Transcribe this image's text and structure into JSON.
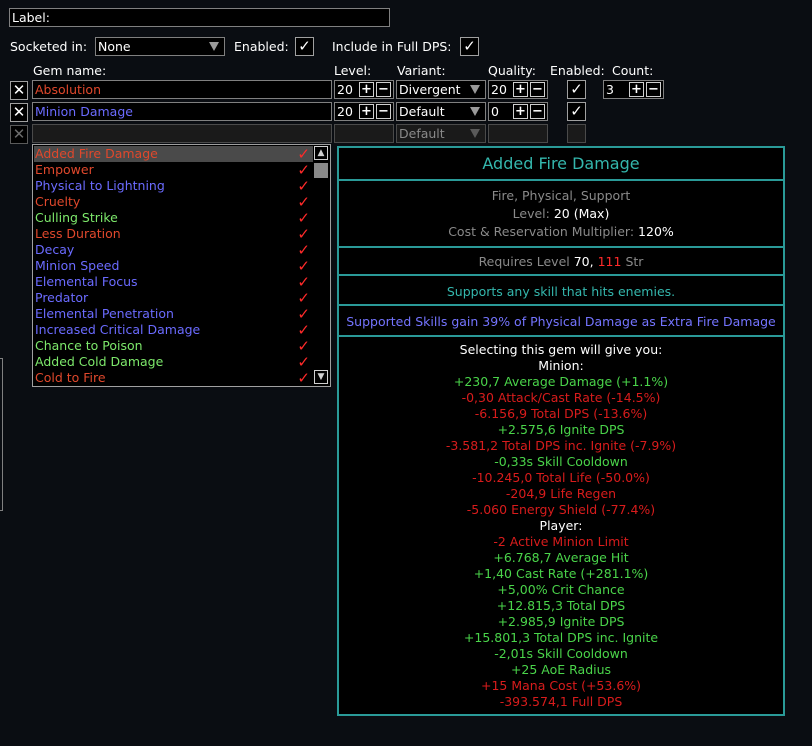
{
  "label_field": {
    "label": "Label:",
    "value": ""
  },
  "socketed_in": {
    "label": "Socketed in:",
    "value": "None"
  },
  "enabled": {
    "label": "Enabled:",
    "checked": "✓"
  },
  "include_full_dps": {
    "label": "Include in Full DPS:",
    "checked": "✓"
  },
  "headers": {
    "gem_name": "Gem name:",
    "level": "Level:",
    "variant": "Variant:",
    "quality": "Quality:",
    "enabled": "Enabled:",
    "count": "Count:"
  },
  "buttons": {
    "remove": "✕",
    "plus": "+",
    "minus": "−",
    "check": "✓",
    "scroll_up": "▲",
    "scroll_down": "▼"
  },
  "gems": [
    {
      "name": "Absolution",
      "color": "str",
      "level": "20",
      "variant": "Divergent",
      "quality": "20",
      "enabled": "✓",
      "count": "3"
    },
    {
      "name": "Minion Damage",
      "color": "int",
      "level": "20",
      "variant": "Default",
      "quality": "0",
      "enabled": "✓"
    },
    {
      "name": "",
      "level": "",
      "variant": "Default",
      "quality": "",
      "enabled": ""
    }
  ],
  "gem_list": [
    {
      "name": "Added Fire Damage",
      "color": "str",
      "selected": true
    },
    {
      "name": "Empower",
      "color": "str"
    },
    {
      "name": "Physical to Lightning",
      "color": "int"
    },
    {
      "name": "Cruelty",
      "color": "str"
    },
    {
      "name": "Culling Strike",
      "color": "dex"
    },
    {
      "name": "Less Duration",
      "color": "str"
    },
    {
      "name": "Decay",
      "color": "int"
    },
    {
      "name": "Minion Speed",
      "color": "int"
    },
    {
      "name": "Elemental Focus",
      "color": "int"
    },
    {
      "name": "Predator",
      "color": "int"
    },
    {
      "name": "Elemental Penetration",
      "color": "int"
    },
    {
      "name": "Increased Critical Damage",
      "color": "int"
    },
    {
      "name": "Chance to Poison",
      "color": "dex"
    },
    {
      "name": "Added Cold Damage",
      "color": "dex"
    },
    {
      "name": "Cold to Fire",
      "color": "str"
    }
  ],
  "tooltip": {
    "title": "Added Fire Damage",
    "tags": "Fire, Physical, Support",
    "level_label": "Level:",
    "level_value": "20 (Max)",
    "cost_label": "Cost & Reservation Multiplier:",
    "cost_value": "120%",
    "requires_label": "Requires Level",
    "requires_level": "70,",
    "requires_str": "111",
    "requires_str_label": "Str",
    "support_text": "Supports any skill that hits enemies.",
    "mod_text": "Supported Skills gain 39% of Physical Damage as Extra Fire Damage",
    "selecting": "Selecting this gem will give you:",
    "minion_header": "Minion:",
    "minion_lines": [
      {
        "text": "+230,7 Average Damage (+1.1%)",
        "tone": "good"
      },
      {
        "text": "-0,30 Attack/Cast Rate (-14.5%)",
        "tone": "bad"
      },
      {
        "text": "-6.156,9 Total DPS (-13.6%)",
        "tone": "bad"
      },
      {
        "text": "+2.575,6 Ignite DPS",
        "tone": "good"
      },
      {
        "text": "-3.581,2 Total DPS inc. Ignite (-7.9%)",
        "tone": "bad"
      },
      {
        "text": "-0,33s Skill Cooldown",
        "tone": "good"
      },
      {
        "text": "-10.245,0 Total Life (-50.0%)",
        "tone": "bad"
      },
      {
        "text": "-204,9 Life Regen",
        "tone": "bad"
      },
      {
        "text": "-5.060 Energy Shield (-77.4%)",
        "tone": "bad"
      }
    ],
    "player_header": "Player:",
    "player_lines": [
      {
        "text": "-2 Active Minion Limit",
        "tone": "bad"
      },
      {
        "text": "+6.768,7 Average Hit",
        "tone": "good"
      },
      {
        "text": "+1,40 Cast Rate (+281.1%)",
        "tone": "good"
      },
      {
        "text": "+5,00% Crit Chance",
        "tone": "good"
      },
      {
        "text": "+12.815,3 Total DPS",
        "tone": "good"
      },
      {
        "text": "+2.985,9 Ignite DPS",
        "tone": "good"
      },
      {
        "text": "+15.801,3 Total DPS inc. Ignite",
        "tone": "good"
      },
      {
        "text": "-2,01s Skill Cooldown",
        "tone": "good"
      },
      {
        "text": "+25 AoE Radius",
        "tone": "good"
      },
      {
        "text": "+15 Mana Cost (+53.6%)",
        "tone": "bad"
      },
      {
        "text": "-393.574,1 Full DPS",
        "tone": "bad"
      }
    ]
  },
  "colors": {
    "str": "#e0482c",
    "int": "#6b6bff",
    "dex": "#7de86b",
    "accent": "#2a9a98",
    "good": "#4ad44a",
    "bad": "#d81c1c"
  }
}
